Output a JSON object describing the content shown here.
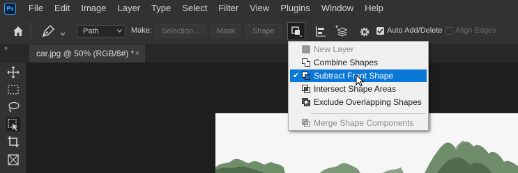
{
  "menu": {
    "logo": "Ps",
    "items": [
      "File",
      "Edit",
      "Image",
      "Layer",
      "Type",
      "Select",
      "Filter",
      "View",
      "Plugins",
      "Window",
      "Help"
    ]
  },
  "options_bar": {
    "mode_value": "Path",
    "make_label": "Make:",
    "selection_label": "Selection...",
    "mask_label": "Mask",
    "shape_label": "Shape",
    "auto_add_delete_label": "Auto Add/Delete",
    "auto_add_delete_checked": true,
    "align_edges_label": "Align Edges",
    "align_edges_checked": false
  },
  "tabs": {
    "collapse_glyph": "»",
    "document_tab": "car.jpg @ 50% (RGB/8#) *",
    "close_glyph": "×"
  },
  "path_operations_menu": {
    "items": [
      {
        "label": "New Layer",
        "icon": "new-layer-icon",
        "enabled": false,
        "selected": false
      },
      {
        "label": "Combine Shapes",
        "icon": "combine-shapes-icon",
        "enabled": true,
        "selected": false
      },
      {
        "label": "Subtract Front Shape",
        "icon": "subtract-front-shape-icon",
        "enabled": true,
        "selected": true
      },
      {
        "label": "Intersect Shape Areas",
        "icon": "intersect-shape-areas-icon",
        "enabled": true,
        "selected": false
      },
      {
        "label": "Exclude Overlapping Shapes",
        "icon": "exclude-overlapping-shapes-icon",
        "enabled": true,
        "selected": false
      },
      {
        "label": "Merge Shape Components",
        "icon": "merge-shape-components-icon",
        "enabled": false,
        "selected": false
      }
    ],
    "check_glyph": "✔"
  },
  "colors": {
    "menu_bar_bg": "#323232",
    "canvas_bg": "#1e1e1e",
    "highlight": "#0a78d7",
    "ps_brand": "#31a8ff"
  }
}
